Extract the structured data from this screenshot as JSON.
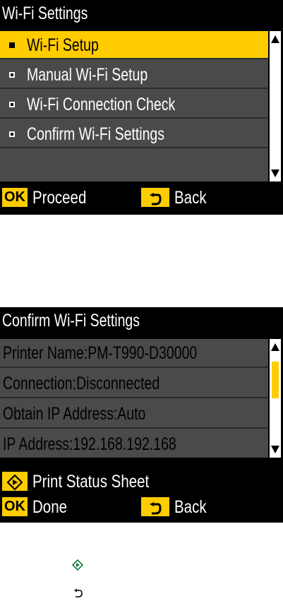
{
  "screen1": {
    "title": "Wi-Fi Settings",
    "menu_items": [
      {
        "label": "Wi-Fi Setup",
        "selected": true
      },
      {
        "label": "Manual Wi-Fi Setup",
        "selected": false
      },
      {
        "label": "Wi-Fi Connection Check",
        "selected": false
      },
      {
        "label": "Confirm Wi-Fi Settings",
        "selected": false
      }
    ],
    "footer": {
      "ok_label": "OK",
      "proceed_label": "Proceed",
      "back_label": "Back"
    }
  },
  "screen2": {
    "title": "Confirm Wi-Fi Settings",
    "rows": [
      "Printer Name:PM-T990-D30000",
      "Connection:Disconnected",
      "Obtain IP Address:Auto",
      "IP Address:192.168.192.168"
    ],
    "footer": {
      "print_status_label": "Print Status Sheet",
      "ok_label": "OK",
      "done_label": "Done",
      "back_label": "Back"
    }
  },
  "icons": {
    "start": "start-diamond-icon",
    "back": "back-arrow-icon"
  },
  "colors": {
    "accent": "#ffcc00",
    "screen_bg": "#000000",
    "row_bg": "#4a4a4a",
    "start_icon_green": "#1a7a3a"
  }
}
